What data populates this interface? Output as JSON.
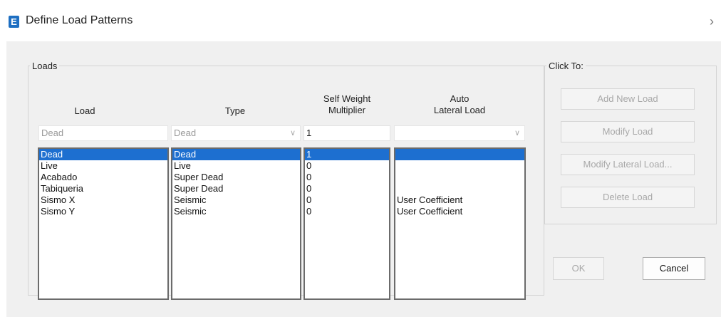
{
  "window": {
    "title": "Define Load Patterns",
    "app_icon_letter": "E",
    "close_glyph": "›"
  },
  "loads_group": {
    "legend": "Loads",
    "columns": {
      "load": "Load",
      "type": "Type",
      "self_weight_line1": "Self Weight",
      "self_weight_line2": "Multiplier",
      "auto_line1": "Auto",
      "auto_line2": "Lateral Load"
    },
    "edit_row": {
      "load_value": "Dead",
      "type_value": "Dead",
      "multiplier_value": "1",
      "auto_value": ""
    },
    "rows": [
      {
        "load": "Dead",
        "type": "Dead",
        "multiplier": "1",
        "auto": "",
        "selected": true
      },
      {
        "load": "Live",
        "type": "Live",
        "multiplier": "0",
        "auto": "",
        "selected": false
      },
      {
        "load": "Acabado",
        "type": "Super Dead",
        "multiplier": "0",
        "auto": "",
        "selected": false
      },
      {
        "load": "Tabiqueria",
        "type": "Super Dead",
        "multiplier": "0",
        "auto": "",
        "selected": false
      },
      {
        "load": "Sismo X",
        "type": "Seismic",
        "multiplier": "0",
        "auto": "User Coefficient",
        "selected": false
      },
      {
        "load": "Sismo Y",
        "type": "Seismic",
        "multiplier": "0",
        "auto": "User Coefficient",
        "selected": false
      }
    ]
  },
  "click_to": {
    "legend": "Click To:",
    "add_new_load": "Add New Load",
    "modify_load": "Modify Load",
    "modify_lateral_load": "Modify Lateral Load...",
    "delete_load": "Delete Load"
  },
  "footer": {
    "ok": "OK",
    "cancel": "Cancel"
  },
  "colors": {
    "selection": "#1d6fd0",
    "app_icon": "#1e6fc2",
    "dialog_bg": "#f0f0f0"
  }
}
